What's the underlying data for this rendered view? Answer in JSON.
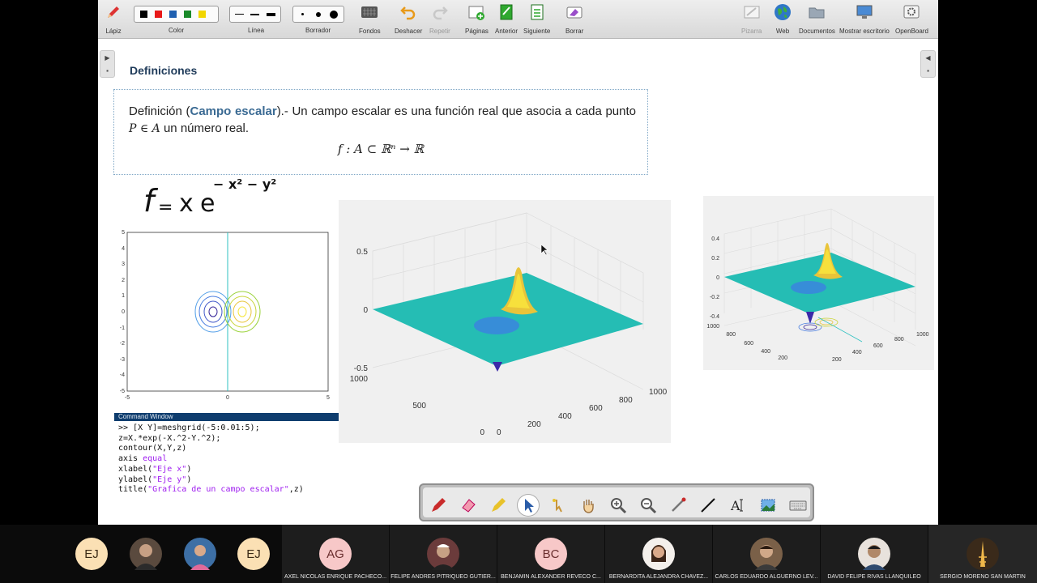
{
  "toolbar": {
    "pencil": "Lápiz",
    "color": "Color",
    "line": "Línea",
    "eraser": "Borrador",
    "backgrounds": "Fondos",
    "undo": "Deshacer",
    "redo": "Repetir",
    "pages": "Páginas",
    "previous": "Anterior",
    "next": "Siguiente",
    "clear": "Borrar",
    "board": "Pizarra",
    "web": "Web",
    "documents": "Documentos",
    "show_desktop": "Mostrar escritorio",
    "openboard": "OpenBoard",
    "colors": [
      "#000000",
      "#e81818",
      "#1f5fb0",
      "#1a8a2a",
      "#f2d600"
    ]
  },
  "page": {
    "heading": "Definiciones",
    "definition": {
      "intro": "Definición (",
      "keyword": "Campo escalar",
      "rest": ").- Un campo escalar es una función real que asocia a cada punto",
      "point": "P ∈ A",
      "end": "un número real.",
      "formula": "f : A ⊂ ℝⁿ → ℝ"
    },
    "handwritten": {
      "f": "f",
      "eq": "=",
      "x": "x",
      "e": "e",
      "exponent": "− x² − y²"
    }
  },
  "contour_plot": {
    "y_ticks": [
      "5",
      "4",
      "3",
      "2",
      "1",
      "0",
      "-1",
      "-2",
      "-3",
      "-4",
      "-5"
    ],
    "x_ticks": [
      "-5",
      "0",
      "5"
    ]
  },
  "surface_plot_large": {
    "z_ticks": [
      "0.5",
      "0",
      "-0.5"
    ],
    "y_ticks": [
      "1000",
      "500",
      "0"
    ],
    "x_ticks": [
      "0",
      "200",
      "400",
      "600",
      "800",
      "1000"
    ]
  },
  "surface_plot_small": {
    "z_ticks": [
      "0.4",
      "0.2",
      "0",
      "-0.2",
      "-0.4"
    ],
    "y_ticks": [
      "1000",
      "800",
      "600",
      "400",
      "200"
    ],
    "x_ticks": [
      "200",
      "400",
      "600",
      "800",
      "1000"
    ]
  },
  "command_window": {
    "title": "Command Window",
    "lines": [
      ">> [X Y]=meshgrid(-5:0.01:5);",
      "z=X.*exp(-X.^2-Y.^2);",
      "contour(X,Y,z)",
      "axis equal",
      "xlabel(",
      "ylabel(",
      "title("
    ],
    "keyword_equal": "equal",
    "xlabel_str": "\"Eje x\"",
    "ylabel_str": "\"Eje y\"",
    "title_str": "\"Grafica de un campo escalar\"",
    "title_tail": ",z)",
    "close_paren": ")",
    "axis_word": "axis "
  },
  "participants": [
    {
      "initials": "EJ",
      "name": "",
      "color": "#fbe0b4"
    },
    {
      "initials": "",
      "name": "",
      "color": "#5a4a3e"
    },
    {
      "initials": "",
      "name": "",
      "color": "#3d6fa5"
    },
    {
      "initials": "EJ",
      "name": "",
      "color": "#fbe0b4"
    },
    {
      "initials": "AG",
      "name": "AXEL NICOLAS ENRIQUE PACHECO...",
      "color": "#f7c8c8"
    },
    {
      "initials": "",
      "name": "FELIPE ANDRES PITRIQUEO GUTIER...",
      "color": "#6b3b3b"
    },
    {
      "initials": "BC",
      "name": "BENJAMIN ALEXANDER REVECO C...",
      "color": "#f7c8c8"
    },
    {
      "initials": "",
      "name": "BERNARDITA ALEJANDRA CHAVEZ...",
      "color": "#c29070"
    },
    {
      "initials": "",
      "name": "CARLOS EDUARDO ALGUERNO LEV...",
      "color": "#7a6048"
    },
    {
      "initials": "",
      "name": "DAVID FELIPE RIVAS LLANQUILEO",
      "color": "#7f6a5a"
    },
    {
      "initials": "",
      "name": "SERGIO MORENO SAN MARTIN",
      "color": "#3a2a1a"
    }
  ]
}
